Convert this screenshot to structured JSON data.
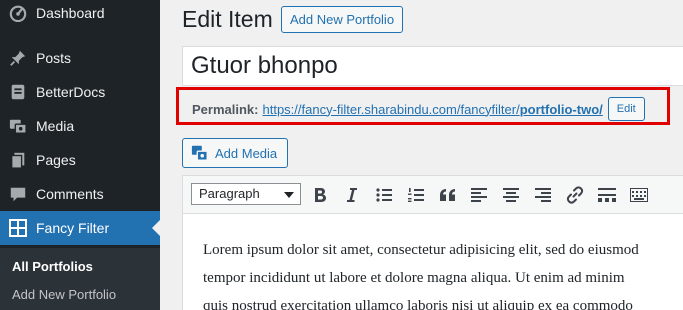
{
  "sidebar": {
    "items": [
      {
        "label": "Dashboard",
        "icon": "dashboard-icon"
      },
      {
        "label": "Posts",
        "icon": "pin-icon"
      },
      {
        "label": "BetterDocs",
        "icon": "docs-icon"
      },
      {
        "label": "Media",
        "icon": "media-icon"
      },
      {
        "label": "Pages",
        "icon": "pages-icon"
      },
      {
        "label": "Comments",
        "icon": "comment-icon"
      },
      {
        "label": "Fancy Filter",
        "icon": "grid-icon"
      }
    ],
    "submenu": [
      {
        "label": "All Portfolios"
      },
      {
        "label": "Add New Portfolio"
      }
    ]
  },
  "header": {
    "title": "Edit Item",
    "add_new_label": "Add New Portfolio"
  },
  "post": {
    "title_value": "Gtuor bhonpo",
    "permalink_label": "Permalink:",
    "permalink_base": "https://fancy-filter.sharabindu.com/fancyfilter/",
    "permalink_slug": "portfolio-two/",
    "permalink_edit": "Edit"
  },
  "media": {
    "add_media_label": "Add Media"
  },
  "editor": {
    "format_value": "Paragraph",
    "toolbar_icons": [
      "bold-icon",
      "italic-icon",
      "bullet-list-icon",
      "numbered-list-icon",
      "blockquote-icon",
      "align-left-icon",
      "align-center-icon",
      "align-right-icon",
      "link-icon",
      "horizontal-rule-icon",
      "toolbar-toggle-icon"
    ],
    "lines": [
      "Lorem ipsum dolor sit amet, consectetur adipisicing elit, sed do eiusmod",
      "tempor incididunt ut labore et dolore magna aliqua. Ut enim ad minim",
      "quis nostrud exercitation ullamco laboris nisi ut aliquip ex ea commodo"
    ]
  },
  "colors": {
    "sidebar_bg": "#1d2327",
    "accent": "#2271b1",
    "highlight_box": "#e00000"
  }
}
